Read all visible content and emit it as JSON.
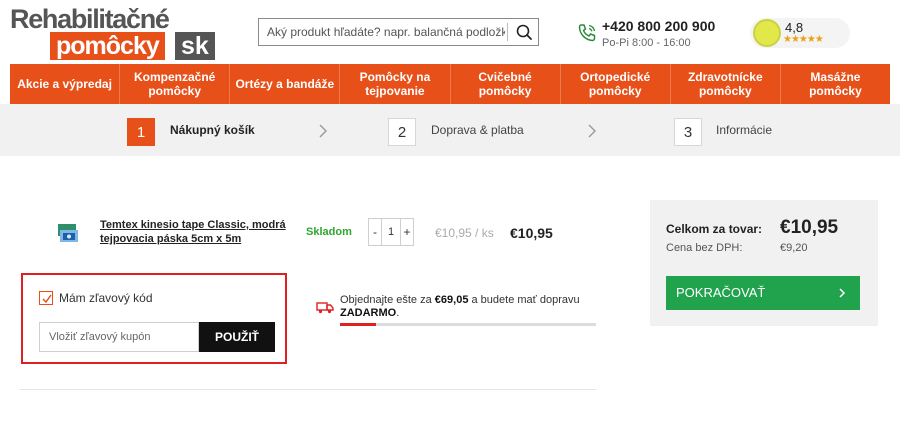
{
  "header": {
    "logo_line1": "Rehabilitačné",
    "logo_line2": "pomôcky",
    "logo_suffix": "sk",
    "search_placeholder": "Aký produkt hľadáte? napr. balančná podložka...",
    "phone_number": "+420 800 200 900",
    "phone_hours": "Po-Pi 8:00 - 16:00",
    "rating_value": "4,8",
    "rating_stars": "★★★★★",
    "rating_stars_value": 4.8,
    "rating_badge_color": "#e2e84a"
  },
  "nav": [
    {
      "label": "Akcie a výpredaj"
    },
    {
      "label": "Kompenzačné pomôcky"
    },
    {
      "label": "Ortézy a bandáže"
    },
    {
      "label": "Pomôcky na tejpovanie"
    },
    {
      "label": "Cvičebné pomôcky"
    },
    {
      "label": "Ortopedické pomôcky"
    },
    {
      "label": "Zdravotnícke pomôcky"
    },
    {
      "label": "Masážne pomôcky"
    }
  ],
  "steps": [
    {
      "num": "1",
      "label": "Nákupný košík",
      "active": true
    },
    {
      "num": "2",
      "label": "Doprava & platba",
      "active": false
    },
    {
      "num": "3",
      "label": "Informácie",
      "active": false
    }
  ],
  "cart": {
    "product_name": "Temtex kinesio tape Classic, modrá tejpovacia páska 5cm x 5m",
    "stock": "Skladom",
    "qty_minus": "-",
    "qty": "1",
    "qty_plus": "+",
    "unit_price": "€10,95 / ks",
    "total_price": "€10,95"
  },
  "coupon": {
    "checkbox_label": "Mám zľavový kód",
    "checked": true,
    "input_placeholder": "Vložiť zľavový kupón",
    "button_label": "POUŽIŤ"
  },
  "shipping": {
    "text_before": "Objednajte ešte za ",
    "amount": "€69,05",
    "text_after": " a budete mať dopravu ",
    "free_label": "ZADARMO",
    "text_end": ".",
    "progress_percent": 14
  },
  "summary": {
    "total_label": "Celkom za tovar:",
    "total_value": "€10,95",
    "net_label": "Cena bez DPH:",
    "net_value": "€9,20",
    "continue_label": "POKRAČOVAŤ"
  },
  "colors": {
    "brand_orange": "#e8501a",
    "success_green": "#21a34d",
    "highlight_red": "#e02020"
  }
}
